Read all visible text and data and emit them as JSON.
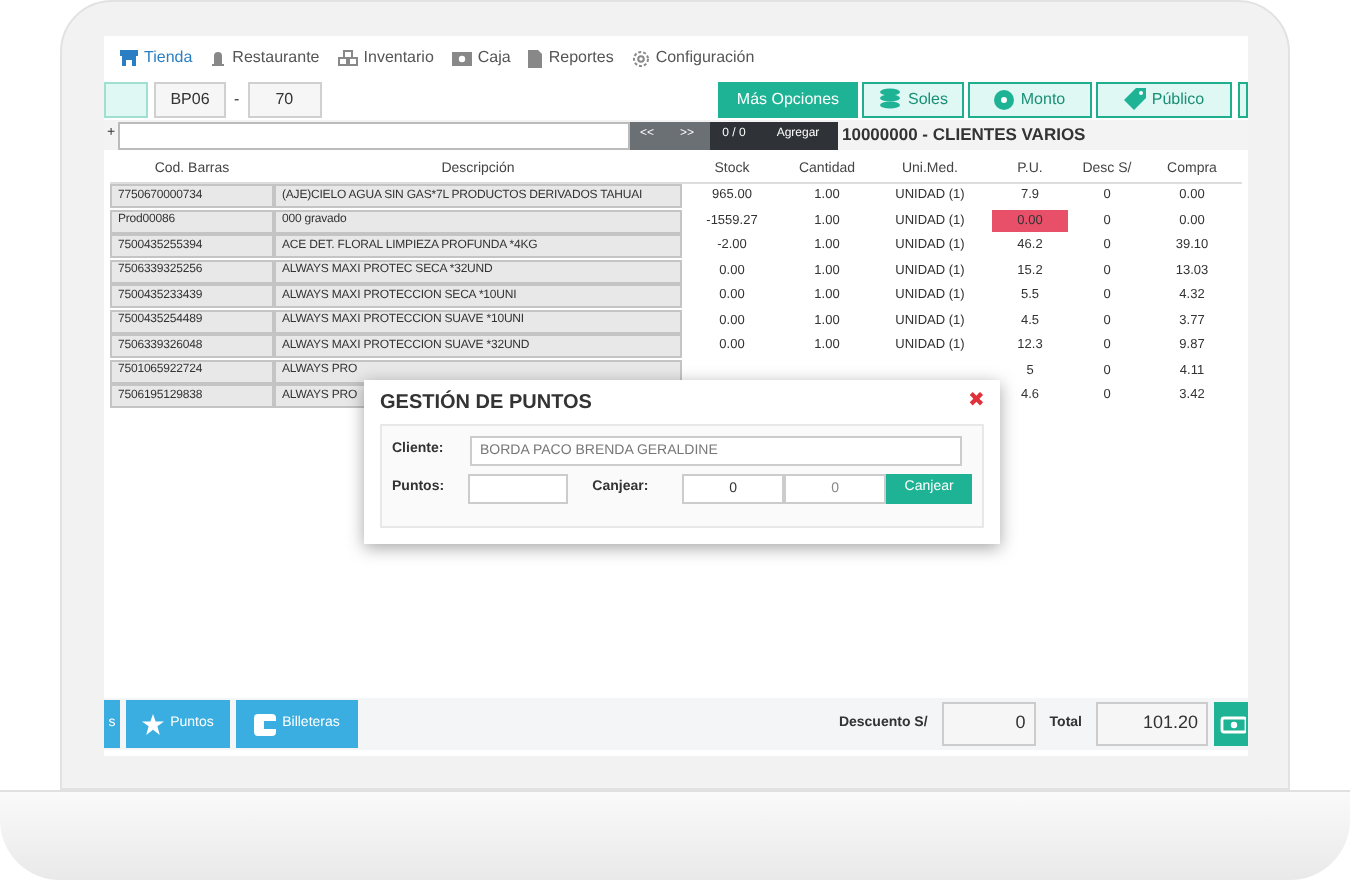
{
  "nav": [
    {
      "label": "Tienda",
      "selected": true,
      "kind": "store"
    },
    {
      "label": "Restaurante",
      "selected": false,
      "kind": "chef"
    },
    {
      "label": "Inventario",
      "selected": false,
      "kind": "boxes"
    },
    {
      "label": "Caja",
      "selected": false,
      "kind": "cash"
    },
    {
      "label": "Reportes",
      "selected": false,
      "kind": "doc"
    },
    {
      "label": "Configuración",
      "selected": false,
      "kind": "gear"
    }
  ],
  "toolbar": {
    "series": "BP06",
    "separator": "-",
    "number": "70",
    "buttons": [
      {
        "label": "Más Opciones",
        "kind": "primary"
      },
      {
        "label": "Soles",
        "kind": "coins"
      },
      {
        "label": "Monto",
        "kind": "badge"
      },
      {
        "label": "Público",
        "kind": "tag"
      }
    ]
  },
  "search": {
    "add_symbol": "+",
    "prev": "<<",
    "next": ">>",
    "count": "0 / 0",
    "add": "Agregar",
    "client": "10000000 - CLIENTES VARIOS"
  },
  "table": {
    "columns": [
      "Cod. Barras",
      "Descripción",
      "Stock",
      "Cantidad",
      "Uni.Med.",
      "P.U.",
      "Desc S/",
      "Compra"
    ],
    "rows": [
      {
        "cells": [
          "7750670000734",
          "(AJE)CIELO AGUA SIN GAS*7L PRODUCTOS DERIVADOS TAHUAI",
          "965.00",
          "1.00",
          "UNIDAD (1)",
          "7.9",
          "0",
          "0.00"
        ],
        "price_alert": false
      },
      {
        "cells": [
          "Prod00086",
          "000 gravado",
          "-1559.27",
          "1.00",
          "UNIDAD (1)",
          "0.00",
          "0",
          "0.00"
        ],
        "price_alert": true
      },
      {
        "cells": [
          "7500435255394",
          "ACE DET. FLORAL LIMPIEZA PROFUNDA *4KG",
          "-2.00",
          "1.00",
          "UNIDAD (1)",
          "46.2",
          "0",
          "39.10"
        ],
        "price_alert": false
      },
      {
        "cells": [
          "7506339325256",
          "ALWAYS MAXI PROTEC SECA *32UND",
          "0.00",
          "1.00",
          "UNIDAD (1)",
          "15.2",
          "0",
          "13.03"
        ],
        "price_alert": false
      },
      {
        "cells": [
          "7500435233439",
          "ALWAYS MAXI PROTECCION SECA *10UNI",
          "0.00",
          "1.00",
          "UNIDAD (1)",
          "5.5",
          "0",
          "4.32"
        ],
        "price_alert": false
      },
      {
        "cells": [
          "7500435254489",
          "ALWAYS MAXI PROTECCION SUAVE *10UNI",
          "0.00",
          "1.00",
          "UNIDAD (1)",
          "4.5",
          "0",
          "3.77"
        ],
        "price_alert": false
      },
      {
        "cells": [
          "7506339326048",
          "ALWAYS MAXI PROTECCION SUAVE *32UND",
          "0.00",
          "1.00",
          "UNIDAD (1)",
          "12.3",
          "0",
          "9.87"
        ],
        "price_alert": false
      },
      {
        "cells": [
          "7501065922724",
          "ALWAYS PRO",
          null,
          null,
          null,
          "5",
          "0",
          "4.11"
        ],
        "price_alert": false
      },
      {
        "cells": [
          "7506195129838",
          "ALWAYS PRO",
          null,
          null,
          null,
          "4.6",
          "0",
          "3.42"
        ],
        "price_alert": false
      }
    ]
  },
  "dialog": {
    "title": "GESTIÓN DE PUNTOS",
    "close": "✖",
    "cliente_label": "Cliente:",
    "cliente_value": "BORDA PACO BRENDA GERALDINE",
    "puntos_label": "Puntos:",
    "canjear_label": "Canjear:",
    "canjear_points": "0",
    "canjear_amount": "0",
    "button": "Canjear"
  },
  "bottom": {
    "buttons": [
      {
        "label": "s",
        "kind": "plain"
      },
      {
        "label": "Puntos",
        "kind": "star"
      },
      {
        "label": "Billeteras",
        "kind": "wallet"
      }
    ],
    "discount_label": "Descuento S/",
    "discount": "0",
    "total_label": "Total",
    "total": "101.20"
  }
}
